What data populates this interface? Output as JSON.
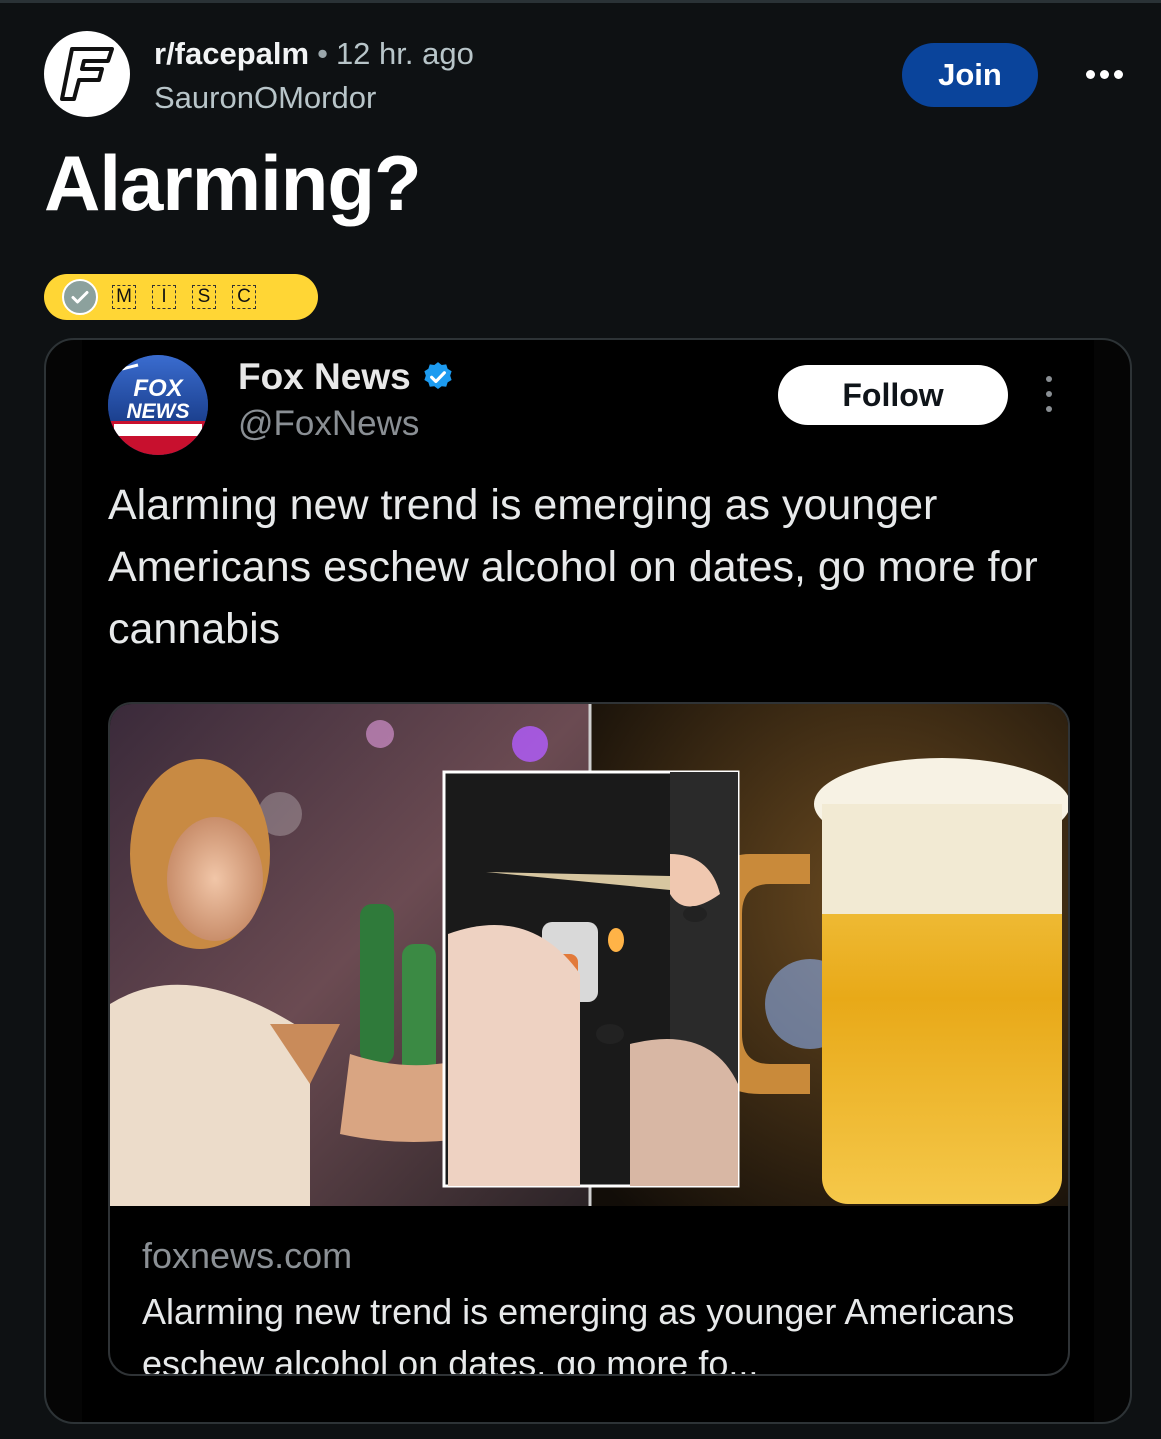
{
  "post": {
    "subreddit": "r/facepalm",
    "separator": "•",
    "time_ago": "12 hr. ago",
    "author": "SauronOMordor",
    "join_label": "Join",
    "title": "Alarming?",
    "flair_letters": [
      "M",
      "I",
      "S",
      "C"
    ]
  },
  "embed": {
    "account_name": "Fox News",
    "handle": "@FoxNews",
    "follow_label": "Follow",
    "tweet_text": "Alarming new trend is emerging as younger Americans eschew alcohol on dates, go more for cannabis",
    "link_domain": "foxnews.com",
    "link_title": "Alarming new trend is emerging as younger Americans eschew alcohol on dates, go more fo..."
  },
  "colors": {
    "background": "#0e1113",
    "join_button": "#0a449b",
    "flair": "#ffd635",
    "verified": "#1d9bf0"
  }
}
